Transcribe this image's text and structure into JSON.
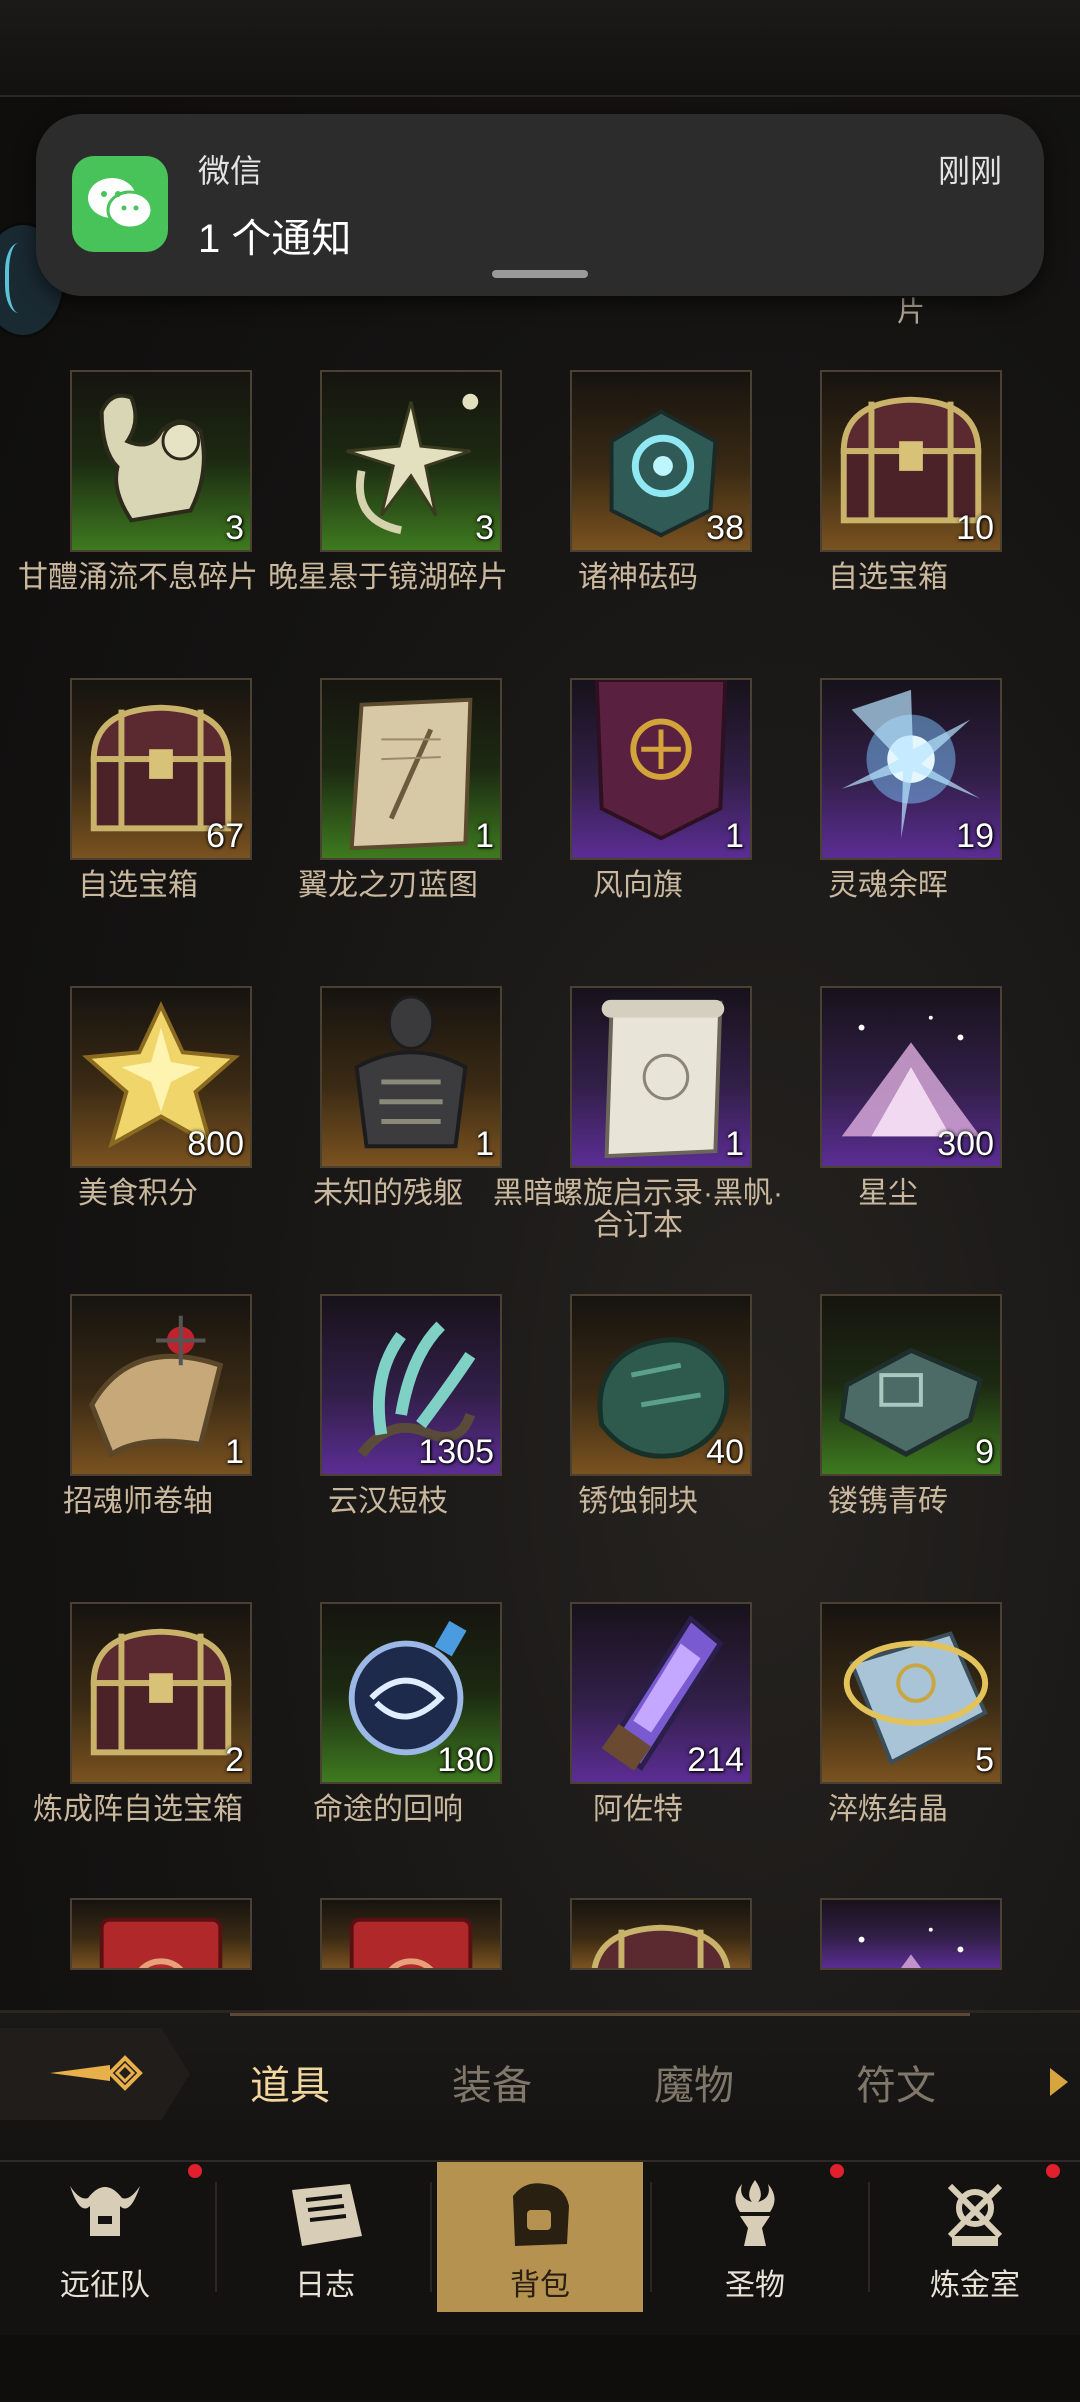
{
  "notification": {
    "app_name": "微信",
    "message": "1 个通知",
    "time": "刚刚"
  },
  "peek_text": "片",
  "items": [
    {
      "name": "甘醴涌流不息碎片",
      "qty": "3",
      "rarity": "green",
      "icon": "fragment-figure-icon"
    },
    {
      "name": "晚星悬于镜湖碎片",
      "qty": "3",
      "rarity": "green",
      "icon": "star-fragment-icon"
    },
    {
      "name": "诸神砝码",
      "qty": "38",
      "rarity": "gold",
      "icon": "weight-cube-icon"
    },
    {
      "name": "自选宝箱",
      "qty": "10",
      "rarity": "gold",
      "icon": "treasure-chest-icon"
    },
    {
      "name": "自选宝箱",
      "qty": "67",
      "rarity": "gold",
      "icon": "treasure-chest-icon"
    },
    {
      "name": "翼龙之刃蓝图",
      "qty": "1",
      "rarity": "green",
      "icon": "blueprint-scroll-icon"
    },
    {
      "name": "风向旗",
      "qty": "1",
      "rarity": "purple",
      "icon": "banner-flag-icon"
    },
    {
      "name": "灵魂余晖",
      "qty": "19",
      "rarity": "purple",
      "icon": "soul-spark-icon"
    },
    {
      "name": "美食积分",
      "qty": "800",
      "rarity": "gold",
      "icon": "gold-star-icon"
    },
    {
      "name": "未知的残躯",
      "qty": "1",
      "rarity": "gold",
      "icon": "remains-bust-icon"
    },
    {
      "name": "黑暗螺旋启示录·黑帆·合订本",
      "qty": "1",
      "rarity": "purple",
      "icon": "scroll-icon"
    },
    {
      "name": "星尘",
      "qty": "300",
      "rarity": "purple",
      "icon": "stardust-pile-icon"
    },
    {
      "name": "招魂师卷轴",
      "qty": "1",
      "rarity": "gold",
      "icon": "rolled-scroll-icon"
    },
    {
      "name": "云汉短枝",
      "qty": "1305",
      "rarity": "purple",
      "icon": "branch-icon"
    },
    {
      "name": "锈蚀铜块",
      "qty": "40",
      "rarity": "gold",
      "icon": "copper-ore-icon"
    },
    {
      "name": "镂镌青砖",
      "qty": "9",
      "rarity": "green",
      "icon": "carved-brick-icon"
    },
    {
      "name": "炼成阵自选宝箱",
      "qty": "2",
      "rarity": "gold",
      "icon": "treasure-chest-icon"
    },
    {
      "name": "命途的回响",
      "qty": "180",
      "rarity": "green",
      "icon": "orb-flask-icon"
    },
    {
      "name": "阿佐特",
      "qty": "214",
      "rarity": "purple",
      "icon": "crystal-vial-icon"
    },
    {
      "name": "淬炼结晶",
      "qty": "5",
      "rarity": "gold",
      "icon": "runic-crystal-icon"
    }
  ],
  "partial_items": [
    {
      "rarity": "gold",
      "icon": "red-card-icon"
    },
    {
      "rarity": "gold",
      "icon": "red-card-icon"
    },
    {
      "rarity": "gold",
      "icon": "treasure-chest-icon"
    },
    {
      "rarity": "purple",
      "icon": "stardust-pile-icon"
    }
  ],
  "tabs": [
    "道具",
    "装备",
    "魔物",
    "符文"
  ],
  "active_tab": "道具",
  "nav": [
    {
      "label": "远征队",
      "icon": "helmet-icon",
      "badge": true
    },
    {
      "label": "日志",
      "icon": "journal-icon",
      "badge": false
    },
    {
      "label": "背包",
      "icon": "backpack-icon",
      "badge": false,
      "active": true
    },
    {
      "label": "圣物",
      "icon": "relic-icon",
      "badge": true
    },
    {
      "label": "炼金室",
      "icon": "alchemy-icon",
      "badge": true
    }
  ],
  "colors": {
    "rarity_green": "#3e7a1f",
    "rarity_gold": "#7a5220",
    "rarity_purple": "#5b2d94",
    "item_label": "#c9b89d",
    "active_tab": "#f1d79d",
    "nav_active": "#b5924f",
    "badge": "#e0202c",
    "wechat_green": "#48c35a"
  }
}
